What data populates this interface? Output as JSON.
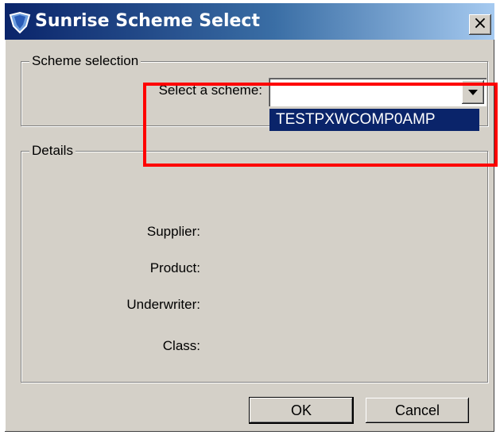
{
  "window": {
    "title": "Sunrise Scheme Select",
    "close_glyph": "×",
    "title_icon": "shield-icon"
  },
  "scheme_selection": {
    "group_label": "Scheme selection",
    "select_label": "Select a scheme:",
    "selected_value": "",
    "dropdown_options": [
      "TESTPXWCOMP0AMP"
    ]
  },
  "details": {
    "group_label": "Details",
    "fields": [
      {
        "label": "Supplier:",
        "value": ""
      },
      {
        "label": "Product:",
        "value": ""
      },
      {
        "label": "Underwriter:",
        "value": ""
      },
      {
        "label": "Class:",
        "value": ""
      }
    ]
  },
  "buttons": {
    "ok_label": "OK",
    "cancel_label": "Cancel"
  },
  "colors": {
    "title_gradient_start": "#0a246a",
    "title_gradient_end": "#a6caf0",
    "dialog_face": "#d4d0c8",
    "selection_bg": "#0a246a",
    "highlight_box": "#ff0000"
  }
}
